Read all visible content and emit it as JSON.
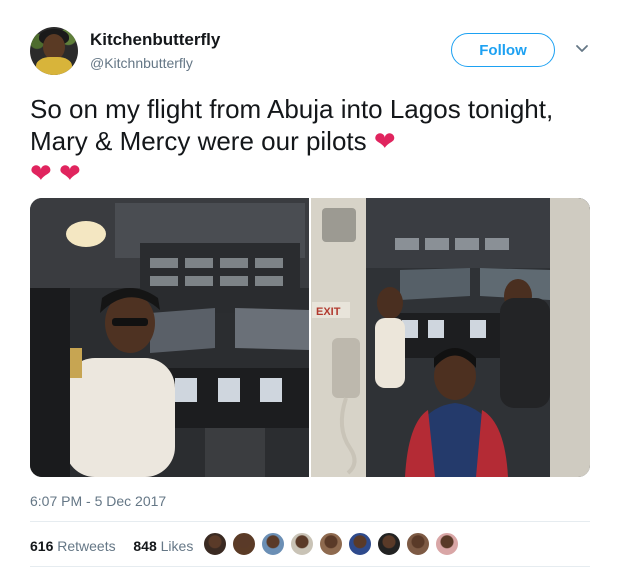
{
  "author": {
    "display_name": "Kitchenbutterfly",
    "handle": "@Kitchnbutterfly"
  },
  "follow_label": "Follow",
  "tweet_text": "So on my flight from Abuja into Lagos tonight, Mary & Mercy were our pilots",
  "timestamp": "6:07 PM - 5 Dec 2017",
  "stats": {
    "retweets_count": "616",
    "retweets_label": "Retweets",
    "likes_count": "848",
    "likes_label": "Likes"
  },
  "media": {
    "exit_sign": "EXIT"
  },
  "icons": {
    "heart": "heart-icon",
    "more": "chevron-down-icon"
  },
  "colors": {
    "accent": "#1da1f2",
    "heart": "#e0245e",
    "secondary_text": "#657786"
  },
  "liker_colors": [
    "#3a2a22",
    "#5b3b26",
    "#6b8fb5",
    "#c9c3b6",
    "#8e6a4f",
    "#2e4a8c",
    "#222222",
    "#7d5a44",
    "#d9a6a6"
  ]
}
